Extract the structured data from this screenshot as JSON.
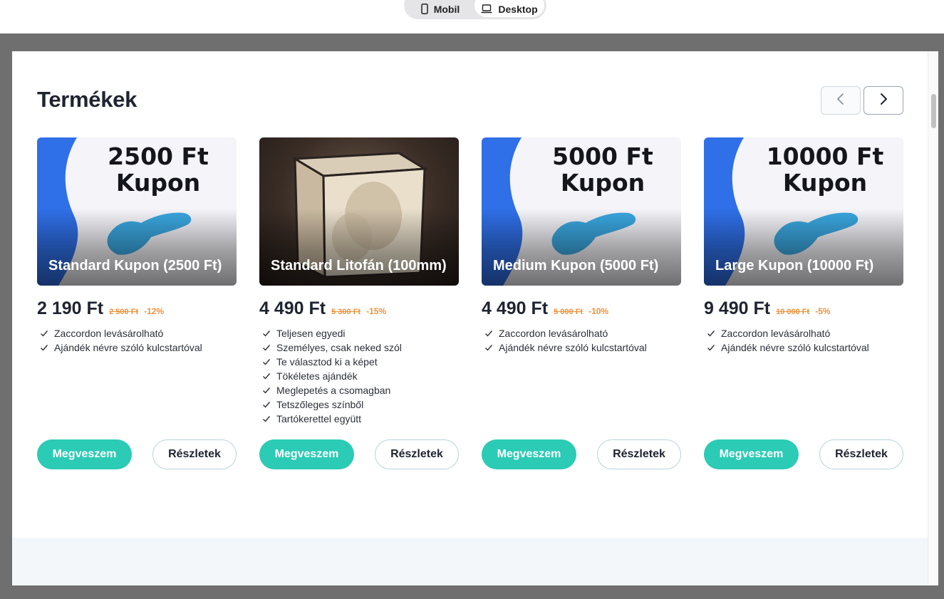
{
  "device_switcher": {
    "mobile_label": "Mobil",
    "desktop_label": "Desktop",
    "mobile_icon": "phone-icon",
    "desktop_icon": "laptop-icon"
  },
  "section": {
    "title": "Termékek",
    "prev_icon": "chevron-left-icon",
    "next_icon": "chevron-right-icon"
  },
  "colors": {
    "accent": "#2ccbb5",
    "discount": "#f0913a",
    "coupon_blue": "#2f6fe8",
    "frame_gray": "#6f6f6f"
  },
  "products": [
    {
      "image_text_line1": "2500 Ft",
      "image_text_line2": "Kupon",
      "title": "Standard Kupon (2500 Ft)",
      "price": "2 190 Ft",
      "old_price": "2 500 Ft",
      "discount": "-12%",
      "features": [
        "Zaccordon levásárolható",
        "Ajándék névre szóló kulcstartóval"
      ],
      "buy_label": "Megveszem",
      "details_label": "Részletek"
    },
    {
      "image_text_line1": "",
      "image_text_line2": "",
      "title": "Standard Litofán (100mm)",
      "price": "4 490 Ft",
      "old_price": "5 300 Ft",
      "discount": "-15%",
      "features": [
        "Teljesen egyedi",
        "Személyes, csak neked szól",
        "Te választod ki a képet",
        "Tökéletes ajándék",
        "Meglepetés a csomagban",
        "Tetszőleges színből",
        "Tartókerettel együtt"
      ],
      "buy_label": "Megveszem",
      "details_label": "Részletek"
    },
    {
      "image_text_line1": "5000 Ft",
      "image_text_line2": "Kupon",
      "title": "Medium Kupon (5000 Ft)",
      "price": "4 490 Ft",
      "old_price": "5 000 Ft",
      "discount": "-10%",
      "features": [
        "Zaccordon levásárolható",
        "Ajándék névre szóló kulcstartóval"
      ],
      "buy_label": "Megveszem",
      "details_label": "Részletek"
    },
    {
      "image_text_line1": "10000 Ft",
      "image_text_line2": "Kupon",
      "title": "Large Kupon (10000 Ft)",
      "price": "9 490 Ft",
      "old_price": "10 000 Ft",
      "discount": "-5%",
      "features": [
        "Zaccordon levásárolható",
        "Ajándék névre szóló kulcstartóval"
      ],
      "buy_label": "Megveszem",
      "details_label": "Részletek"
    }
  ]
}
